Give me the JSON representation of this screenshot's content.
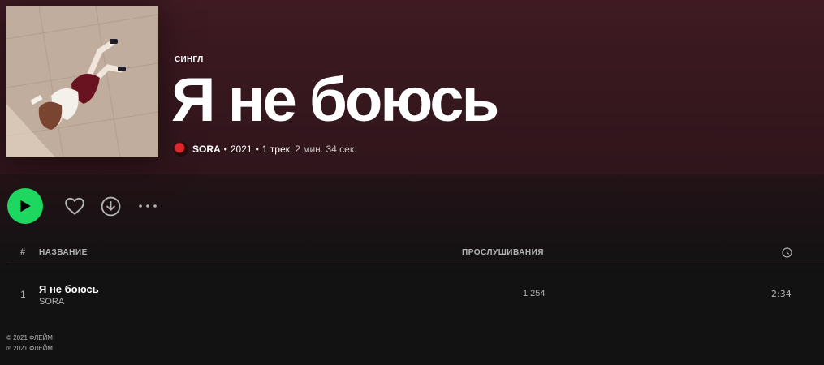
{
  "release": {
    "type_label": "СИНГЛ",
    "title": "Я не боюсь",
    "artist": "SORA",
    "year": "2021",
    "track_count": "1 трек,",
    "duration": "2 мин. 34 сек."
  },
  "actions": {
    "play_icon": "play-icon",
    "like_icon": "heart-icon",
    "download_icon": "download-icon",
    "more_icon": "more-icon"
  },
  "table": {
    "headers": {
      "number": "#",
      "title": "НАЗВАНИЕ",
      "plays": "ПРОСЛУШИВАНИЯ",
      "duration_icon": "clock-icon"
    },
    "tracks": [
      {
        "number": "1",
        "title": "Я не боюсь",
        "artist": "SORA",
        "plays": "1 254",
        "duration": "2:34"
      }
    ]
  },
  "copyright": {
    "c": "© 2021 ФЛЕЙМ",
    "p": "℗ 2021 ФЛЕЙМ"
  },
  "colors": {
    "header_bg": "#3f1a22",
    "accent": "#1ed760",
    "page_bg": "#121212"
  }
}
